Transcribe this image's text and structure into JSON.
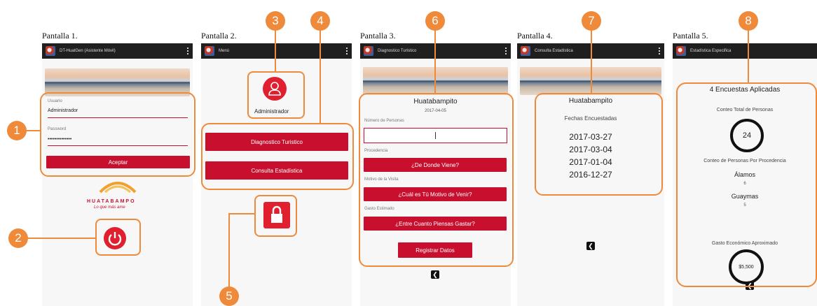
{
  "screens": [
    {
      "caption": "Pantalla 1.",
      "app_title": "DT-HuatGen (Asistente Móvil)",
      "usuario_label": "Usuario",
      "usuario_value": "Administrador",
      "password_label": "Password",
      "password_value": "••••••••••••••",
      "accept_label": "Aceptar",
      "logo_word": "HUATABAMPO",
      "logo_tagline": "Lo que más ame"
    },
    {
      "caption": "Pantalla 2.",
      "app_title": "Menú",
      "user_label": "Administrador",
      "btn_diagnostico": "Diagnostico Turistico",
      "btn_consulta": "Consulta Estadística"
    },
    {
      "caption": "Pantalla 3.",
      "app_title": "Diagnostico Turistico",
      "title": "Huatabampito",
      "date": "2017-04-05",
      "personas_label": "Número de Personas",
      "procedencia_label": "Procedencia",
      "procedencia_btn": "¿De Donde Viene?",
      "motivo_label": "Motivo de la Visita",
      "motivo_btn": "¿Cuál es Tú Motivo de Venir?",
      "gasto_label": "Gasto Estimado",
      "gasto_btn": "¿Entre Cuanto Piensas Gastar?",
      "registrar_btn": "Registrar Datos"
    },
    {
      "caption": "Pantalla 4.",
      "app_title": "Consulta Estadística",
      "title": "Huatabampito",
      "subtitle": "Fechas Encuestadas",
      "dates": [
        "2017-03-27",
        "2017-03-04",
        "2017-01-04",
        "2016-12-27"
      ]
    },
    {
      "caption": "Pantalla 5.",
      "app_title": "Estadística Especifica",
      "encuestas": "4 Encuestas Aplicadas",
      "conteo_label": "Conteo Total de Personas",
      "conteo_value": "24",
      "procedencia_label": "Conteo de Personas Por Procedencia",
      "place1": "Álamos",
      "place1_count": "6",
      "place2": "Guaymas",
      "place2_count": "5",
      "gasto_label": "Gasto Económico Aproximado",
      "gasto_value": "$5,500"
    }
  ],
  "callouts": [
    "1",
    "2",
    "3",
    "4",
    "5",
    "6",
    "7",
    "8"
  ],
  "back_glyph": "❮",
  "colors": {
    "accent": "#ef8a3a",
    "button_red": "#c8102e",
    "appbar": "#1f1f1f"
  }
}
